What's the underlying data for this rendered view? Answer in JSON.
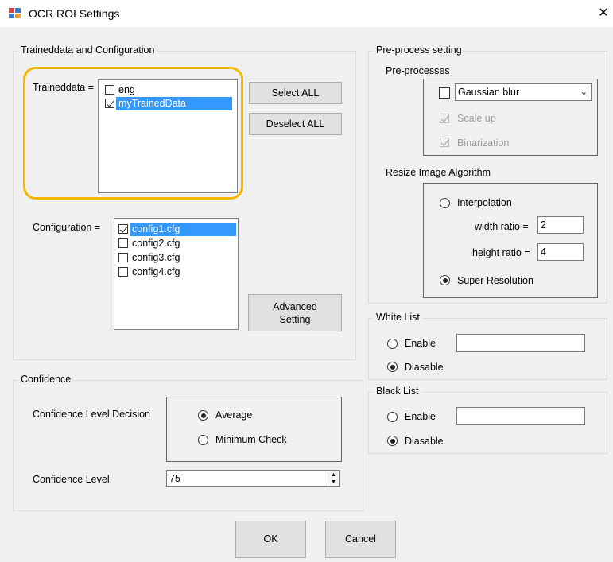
{
  "window": {
    "title": "OCR ROI Settings",
    "close_glyph": "✕",
    "icon": "app-windows-icon"
  },
  "traineddata_group": {
    "title": "Traineddata and Configuration",
    "traineddata_label": "Traineddata =",
    "traineddata_items": [
      {
        "label": "eng",
        "checked": false,
        "selected": false
      },
      {
        "label": "myTrainedData",
        "checked": true,
        "selected": true
      }
    ],
    "select_all_label": "Select ALL",
    "deselect_all_label": "Deselect ALL",
    "configuration_label": "Configuration =",
    "configuration_items": [
      {
        "label": "config1.cfg",
        "checked": true,
        "selected": true
      },
      {
        "label": "config2.cfg",
        "checked": false,
        "selected": false
      },
      {
        "label": "config3.cfg",
        "checked": false,
        "selected": false
      },
      {
        "label": "config4.cfg",
        "checked": false,
        "selected": false
      }
    ],
    "advanced_label_line1": "Advanced",
    "advanced_label_line2": "Setting"
  },
  "confidence_group": {
    "title": "Confidence",
    "decision_label": "Confidence Level Decision",
    "options": [
      {
        "label": "Average",
        "selected": true
      },
      {
        "label": "Minimum Check",
        "selected": false
      }
    ],
    "level_label": "Confidence Level",
    "level_value": "75"
  },
  "preprocess_group": {
    "title": "Pre-process setting",
    "preprocesses_label": "Pre-processes",
    "blur_select_value": "Gaussian blur",
    "blur_checked": false,
    "scale_up_label": "Scale up",
    "scale_up_checked": true,
    "binarization_label": "Binarization",
    "binarization_checked": true,
    "resize_label": "Resize Image Algorithm",
    "interpolation_label": "Interpolation",
    "interpolation_selected": false,
    "width_ratio_label": "width ratio =",
    "width_ratio_value": "2",
    "height_ratio_label": "height ratio =",
    "height_ratio_value": "4",
    "super_resolution_label": "Super Resolution",
    "super_resolution_selected": true
  },
  "white_list_group": {
    "title": "White List",
    "enable_label": "Enable",
    "disable_label": "Diasable",
    "enabled": false,
    "value": ""
  },
  "black_list_group": {
    "title": "Black List",
    "enable_label": "Enable",
    "disable_label": "Diasable",
    "enabled": false,
    "value": ""
  },
  "footer": {
    "ok_label": "OK",
    "cancel_label": "Cancel"
  },
  "colors": {
    "highlight": "#f5b800",
    "selection": "#3399ff",
    "client_bg": "#f0f0f0"
  }
}
